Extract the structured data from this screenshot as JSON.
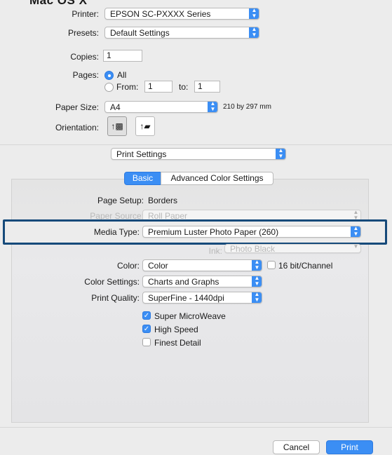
{
  "heading": "Mac OS X",
  "printer": {
    "label": "Printer:",
    "value": "EPSON SC-PXXXX Series"
  },
  "presets": {
    "label": "Presets:",
    "value": "Default Settings"
  },
  "copies": {
    "label": "Copies:",
    "value": "1"
  },
  "pages": {
    "label": "Pages:",
    "all_label": "All",
    "from_label": "From:",
    "from_value": "1",
    "to_label": "to:",
    "to_value": "1"
  },
  "paper_size": {
    "label": "Paper Size:",
    "value": "A4",
    "dimensions": "210 by 297 mm"
  },
  "orientation": {
    "label": "Orientation:"
  },
  "section_popup": "Print Settings",
  "tabs": {
    "basic": "Basic",
    "advanced": "Advanced Color Settings"
  },
  "page_setup": {
    "label": "Page Setup:",
    "value": "Borders"
  },
  "paper_source": {
    "label": "Paper Source:",
    "value": "Roll Paper"
  },
  "media_type": {
    "label": "Media Type:",
    "value": "Premium Luster Photo Paper (260)"
  },
  "ink": {
    "label": "Ink:",
    "value": "Photo Black"
  },
  "color": {
    "label": "Color:",
    "value": "Color",
    "bit_label": "16 bit/Channel"
  },
  "color_settings": {
    "label": "Color Settings:",
    "value": "Charts and Graphs"
  },
  "print_quality": {
    "label": "Print Quality:",
    "value": "SuperFine - 1440dpi"
  },
  "options": {
    "super_microweave": "Super MicroWeave",
    "high_speed": "High Speed",
    "finest_detail": "Finest Detail"
  },
  "buttons": {
    "cancel": "Cancel",
    "print": "Print"
  },
  "colors": {
    "accent": "#3b8ef4",
    "highlight_border": "#164a7a"
  }
}
